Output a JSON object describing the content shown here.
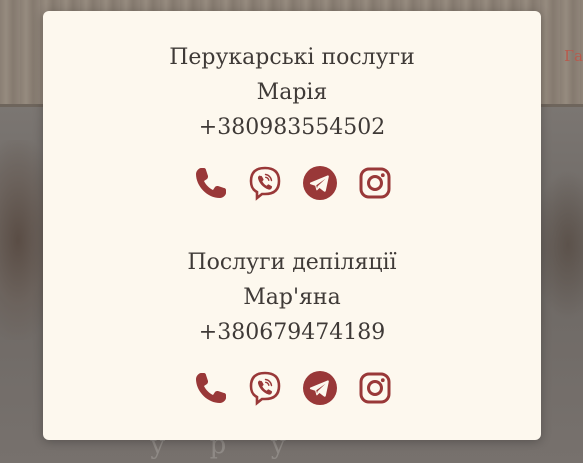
{
  "background": {
    "header_partial_text": "Га",
    "hero_partial_text": "у р у"
  },
  "modal": {
    "contacts": [
      {
        "service": "Перукарські послуги",
        "name": "Марія",
        "phone": "+380983554502"
      },
      {
        "service": "Послуги депіляції",
        "name": "Мар'яна",
        "phone": "+380679474189"
      }
    ],
    "icons": [
      "phone-icon",
      "viber-icon",
      "telegram-icon",
      "instagram-icon"
    ]
  },
  "colors": {
    "accent": "#993838",
    "modal_bg": "#fdf8ee",
    "text": "#3f3a37"
  }
}
